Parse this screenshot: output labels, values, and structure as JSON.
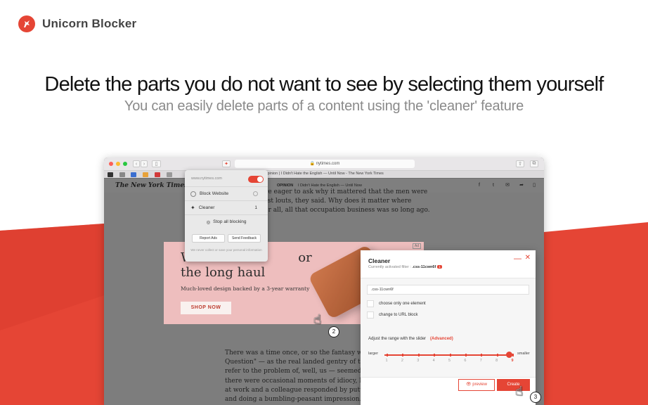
{
  "brand": {
    "name": "Unicorn Blocker",
    "logo_icon": "unicorn-icon",
    "accent": "#e54535"
  },
  "hero": {
    "headline": "Delete the parts you do not want to see by selecting them yourself",
    "subhead": "You can easily delete parts of a content using the 'cleaner' feature"
  },
  "browser": {
    "url": "nytimes.com",
    "tab_title": "Opinion | I Didn't Hate the English — Until Now - The New York Times"
  },
  "nyt": {
    "logo": "The New York Times",
    "section": "OPINION",
    "headline": "I Didn't Hate the English — Until Now",
    "article_top": [
      "were eager to ask why it mattered that the men were",
      "e just louts, they said. Why does it matter where",
      "after all, all that occupation business was so long ago."
    ],
    "article_bottom": [
      "There was a time once, or so the fantasy went, wh",
      "Question\" — as the real landed gentry of two cent",
      "refer to the problem of, well, us — seemed more",
      "there were occasional moments of idiocy, like wh",
      "at work and a colleague responded by putting on",
      "and doing a bumbling-peasant impression. Sure, the English still believed"
    ]
  },
  "ad": {
    "line1": "W                          or",
    "line2": "the long haul",
    "tagline": "Much-loved design backed by a 3-year warranty",
    "cta": "SHOP NOW",
    "tag": "Ad"
  },
  "popup": {
    "host": "www.nytimes.com",
    "block_website": "Block Website",
    "cleaner": "Cleaner",
    "cleaner_count": "1",
    "stop_all": "Stop all blocking",
    "report": "Report Ads",
    "feedback": "Send Feedback",
    "note": "We never collect or save your personal information"
  },
  "cleaner": {
    "title": "Cleaner",
    "sub_prefix": "Currently activated filter : ",
    "active_filter": ".css-11cwn6f",
    "filter_badge": "1",
    "input_value": ".css-11cwn6f",
    "opt_one": "choose only one element",
    "opt_url": "change to URL block",
    "range_label": "Adjust the range with the slider",
    "advanced": "(Advanced)",
    "larger": "larger",
    "smaller": "smaller",
    "scale": [
      "1",
      "2",
      "3",
      "4",
      "5",
      "6",
      "7",
      "8",
      "9"
    ],
    "slider_value": 9,
    "preview": "preview",
    "create": "Create"
  },
  "steps": {
    "two": "2",
    "three": "3"
  }
}
